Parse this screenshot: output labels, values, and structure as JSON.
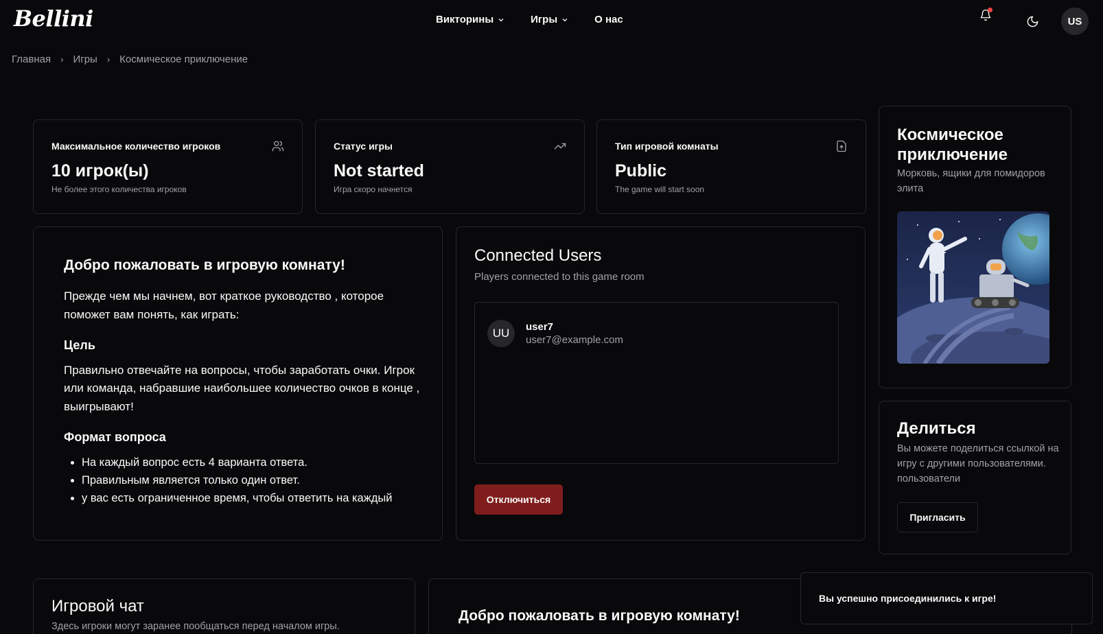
{
  "header": {
    "logo": "Bellini",
    "nav": [
      {
        "label": "Викторины",
        "has_dropdown": true
      },
      {
        "label": "Игры",
        "has_dropdown": true
      },
      {
        "label": "О нас",
        "has_dropdown": false
      }
    ],
    "avatar_initials": "US",
    "icons": [
      "bell-icon",
      "moon-icon"
    ]
  },
  "breadcrumb": [
    "Главная",
    "Игры",
    "Космическое приключение"
  ],
  "stats": [
    {
      "title": "Максимальное количество игроков",
      "value": "10 игрок(ы)",
      "sub": "Не более этого количества игроков",
      "icon": "users-icon"
    },
    {
      "title": "Статус игры",
      "value": "Not started",
      "sub": "Игра скоро начнется",
      "icon": "trending-up-icon"
    },
    {
      "title": "Тип игровой комнаты",
      "value": "Public",
      "sub": "The game will start soon",
      "icon": "file-icon"
    }
  ],
  "welcome": {
    "title": "Добро пожаловать в игровую комнату!",
    "intro": "Прежде чем мы начнем, вот краткое руководство , которое поможет вам понять, как играть:",
    "goal_title": "Цель",
    "goal_text": "Правильно отвечайте на вопросы, чтобы заработать очки. Игрок или команда, набравшие наибольшее количество очков в конце , выигрывают!",
    "format_title": "Формат вопроса",
    "format_items": [
      "На каждый вопрос есть 4 варианта ответа.",
      "Правильным является только один ответ.",
      "у вас есть ограниченное время, чтобы ответить на каждый"
    ]
  },
  "connected": {
    "title": "Connected Users",
    "subtitle": "Players connected to this game room",
    "users": [
      {
        "initials": "UU",
        "name": "user7",
        "email": "user7@example.com"
      }
    ],
    "disconnect_label": "Отключиться"
  },
  "game_info": {
    "title": "Космическое приключение",
    "description": "Морковь, ящики для помидоров элита"
  },
  "share": {
    "title": "Делиться",
    "description": "Вы можете поделиться ссылкой на игру с другими пользователями. пользователи",
    "invite_label": "Пригласить"
  },
  "chat": {
    "title": "Игровой чат",
    "subtitle": "Здесь игроки могут заранее пообщаться перед началом игры."
  },
  "bottom_welcome": {
    "title": "Добро пожаловать в игровую комнату!"
  },
  "toast": {
    "message": "Вы успешно присоединились к игре!"
  },
  "colors": {
    "background": "#09090b",
    "border": "#27272a",
    "muted_text": "#a1a1aa",
    "danger_button": "#7f1d1d",
    "notification_dot": "#ef4444"
  }
}
